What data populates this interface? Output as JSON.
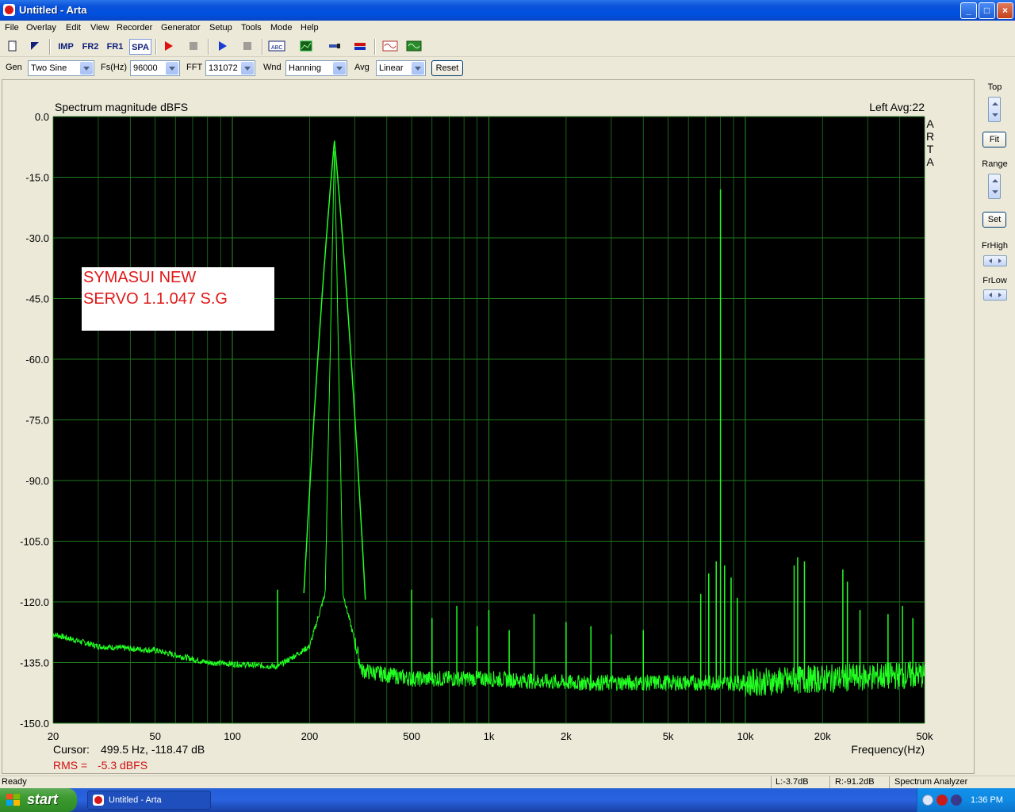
{
  "window": {
    "title": "Untitled - Arta",
    "minimize": "_",
    "maximize": "□",
    "close": "×"
  },
  "menu": [
    "File",
    "Overlay",
    "Edit",
    "View",
    "Recorder",
    "Generator",
    "Setup",
    "Tools",
    "Mode",
    "Help"
  ],
  "toolbar": {
    "impulse": "IMP",
    "fr2": "FR2",
    "fr1": "FR1",
    "spa": "SPA",
    "icons": [
      "new-icon",
      "open-icon",
      "record-icon",
      "stop-icon",
      "play-icon",
      "stop2-icon",
      "abc-icon",
      "chart-icon",
      "probe-icon",
      "level-icon",
      "generator-icon",
      "scope-icon"
    ]
  },
  "controls": {
    "gen_label": "Gen",
    "gen_value": "Two Sine",
    "fs_label": "Fs(Hz)",
    "fs_value": "96000",
    "fft_label": "FFT",
    "fft_value": "131072",
    "wnd_label": "Wnd",
    "wnd_value": "Hanning",
    "avg_label": "Avg",
    "avg_value": "Linear",
    "reset_label": "Reset"
  },
  "side_panel": {
    "top_label": "Top",
    "fit_label": "Fit",
    "range_label": "Range",
    "set_label": "Set",
    "frhigh_label": "FrHigh",
    "frlow_label": "FrLow"
  },
  "plot": {
    "title": "Spectrum magnitude dBFS",
    "channel_info": "Left  Avg:22",
    "arta_vertical": [
      "A",
      "R",
      "T",
      "A"
    ],
    "annotation_line1": "SYMASUI NEW",
    "annotation_line2": "SERVO 1.1.047 S.G",
    "cursor_label": "Cursor:",
    "cursor_value": "499.5 Hz, -118.47 dB",
    "rms_label": "RMS =",
    "rms_value": "-5.3 dBFS",
    "xlabel": "Frequency(Hz)"
  },
  "chart_data": {
    "type": "line",
    "title": "Spectrum magnitude dBFS",
    "xlabel": "Frequency(Hz)",
    "ylabel": "",
    "x_scale": "log",
    "xlim": [
      20,
      50000
    ],
    "ylim": [
      -150,
      0
    ],
    "x_tick_labels": [
      "20",
      "50",
      "100",
      "200",
      "500",
      "1k",
      "2k",
      "5k",
      "10k",
      "20k",
      "50k"
    ],
    "x_tick_values": [
      20,
      50,
      100,
      200,
      500,
      1000,
      2000,
      5000,
      10000,
      20000,
      50000
    ],
    "y_tick_labels": [
      "0.0",
      "-15.0",
      "-30.0",
      "-45.0",
      "-60.0",
      "-75.0",
      "-90.0",
      "-105.0",
      "-120.0",
      "-135.0",
      "-150.0"
    ],
    "y_tick_values": [
      0,
      -15,
      -30,
      -45,
      -60,
      -75,
      -90,
      -105,
      -120,
      -135,
      -150
    ],
    "grid": true,
    "background": "#000000",
    "grid_color": "#1f7a1f",
    "line_color": "#22ff22",
    "noise_floor": [
      [
        20,
        -128
      ],
      [
        30,
        -131
      ],
      [
        50,
        -132
      ],
      [
        80,
        -135
      ],
      [
        150,
        -136
      ],
      [
        200,
        -131
      ],
      [
        230,
        -118
      ],
      [
        250,
        -7
      ],
      [
        270,
        -118
      ],
      [
        320,
        -137
      ],
      [
        500,
        -139
      ],
      [
        1000,
        -139
      ],
      [
        2000,
        -140
      ],
      [
        5000,
        -140
      ],
      [
        10000,
        -140
      ],
      [
        20000,
        -139
      ],
      [
        50000,
        -138
      ]
    ],
    "spikes": [
      {
        "f": 150,
        "db": -117
      },
      {
        "f": 250,
        "db": -6
      },
      {
        "f": 500,
        "db": -117
      },
      {
        "f": 600,
        "db": -124
      },
      {
        "f": 750,
        "db": -121
      },
      {
        "f": 900,
        "db": -126
      },
      {
        "f": 1000,
        "db": -122
      },
      {
        "f": 1200,
        "db": -127
      },
      {
        "f": 1500,
        "db": -123
      },
      {
        "f": 2000,
        "db": -125
      },
      {
        "f": 2500,
        "db": -126
      },
      {
        "f": 3000,
        "db": -128
      },
      {
        "f": 4000,
        "db": -127
      },
      {
        "f": 6700,
        "db": -118
      },
      {
        "f": 7200,
        "db": -113
      },
      {
        "f": 7700,
        "db": -110
      },
      {
        "f": 8000,
        "db": -18
      },
      {
        "f": 8300,
        "db": -111
      },
      {
        "f": 8800,
        "db": -114
      },
      {
        "f": 9300,
        "db": -119
      },
      {
        "f": 15500,
        "db": -111
      },
      {
        "f": 16000,
        "db": -109
      },
      {
        "f": 17000,
        "db": -110
      },
      {
        "f": 24000,
        "db": -112
      },
      {
        "f": 25000,
        "db": -115
      },
      {
        "f": 28000,
        "db": -122
      },
      {
        "f": 36000,
        "db": -123
      },
      {
        "f": 41000,
        "db": -121
      },
      {
        "f": 45000,
        "db": -124
      }
    ]
  },
  "statusbar": {
    "ready": "Ready",
    "left": "L:-3.7dB",
    "right": "R:-91.2dB",
    "mode": "Spectrum Analyzer"
  },
  "taskbar": {
    "start": "start",
    "task_title": "Untitled - Arta",
    "clock": "1:36 PM"
  }
}
